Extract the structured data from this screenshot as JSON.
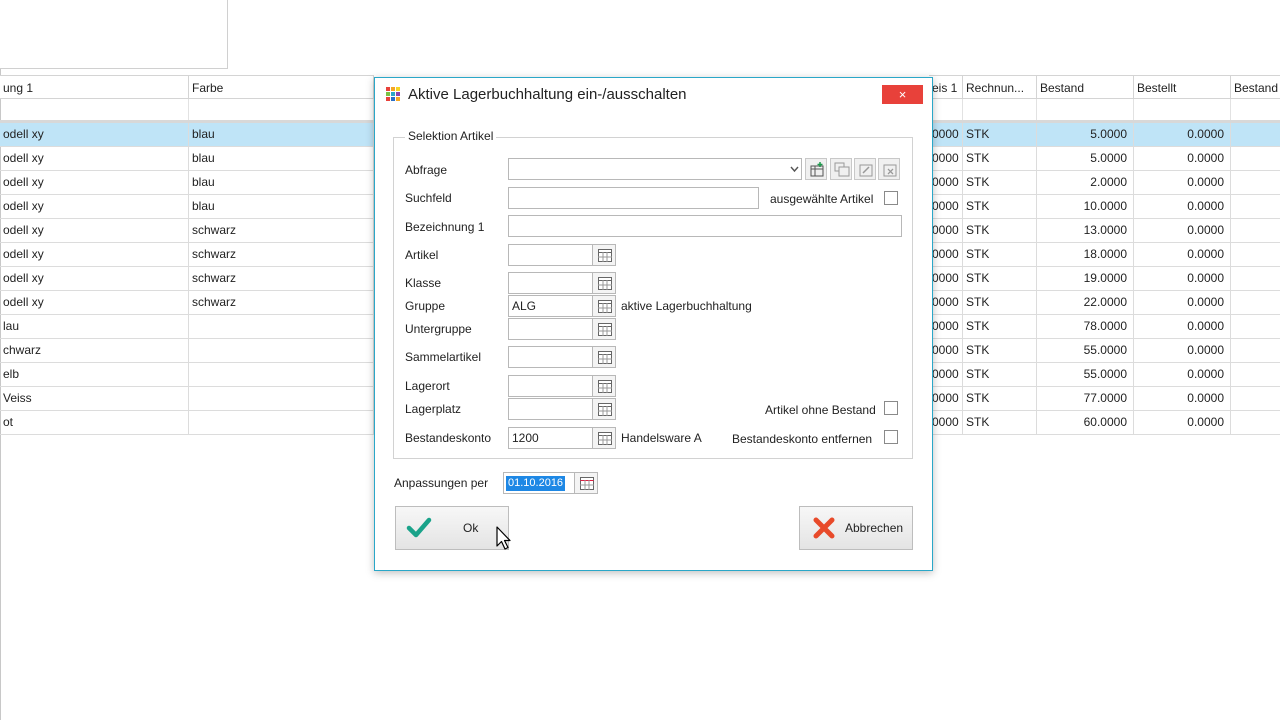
{
  "grid": {
    "columns": [
      {
        "key": "bez1",
        "label": "ung 1"
      },
      {
        "key": "farbe",
        "label": "Farbe"
      },
      {
        "key": "preis",
        "label": "eis 1"
      },
      {
        "key": "einheit",
        "label": "Rechnun..."
      },
      {
        "key": "bestand",
        "label": "Bestand"
      },
      {
        "key": "bestellt",
        "label": "Bestellt"
      },
      {
        "key": "bestand2",
        "label": "Bestand"
      }
    ],
    "rows": [
      {
        "bez1": "odell xy",
        "farbe": "blau",
        "preis": "0000",
        "einheit": "STK",
        "bestand": "5.0000",
        "bestellt": "0.0000",
        "bestand2": ""
      },
      {
        "bez1": "odell xy",
        "farbe": "blau",
        "preis": "0000",
        "einheit": "STK",
        "bestand": "5.0000",
        "bestellt": "0.0000",
        "bestand2": ""
      },
      {
        "bez1": "odell xy",
        "farbe": "blau",
        "preis": "0000",
        "einheit": "STK",
        "bestand": "2.0000",
        "bestellt": "0.0000",
        "bestand2": ""
      },
      {
        "bez1": "odell xy",
        "farbe": "blau",
        "preis": "0000",
        "einheit": "STK",
        "bestand": "10.0000",
        "bestellt": "0.0000",
        "bestand2": ""
      },
      {
        "bez1": "odell xy",
        "farbe": "schwarz",
        "preis": "0000",
        "einheit": "STK",
        "bestand": "13.0000",
        "bestellt": "0.0000",
        "bestand2": ""
      },
      {
        "bez1": "odell xy",
        "farbe": "schwarz",
        "preis": "0000",
        "einheit": "STK",
        "bestand": "18.0000",
        "bestellt": "0.0000",
        "bestand2": ""
      },
      {
        "bez1": "odell xy",
        "farbe": "schwarz",
        "preis": "0000",
        "einheit": "STK",
        "bestand": "19.0000",
        "bestellt": "0.0000",
        "bestand2": ""
      },
      {
        "bez1": "odell xy",
        "farbe": "schwarz",
        "preis": "0000",
        "einheit": "STK",
        "bestand": "22.0000",
        "bestellt": "0.0000",
        "bestand2": ""
      },
      {
        "bez1": "lau",
        "farbe": "",
        "preis": "0000",
        "einheit": "STK",
        "bestand": "78.0000",
        "bestellt": "0.0000",
        "bestand2": ""
      },
      {
        "bez1": "chwarz",
        "farbe": "",
        "preis": "0000",
        "einheit": "STK",
        "bestand": "55.0000",
        "bestellt": "0.0000",
        "bestand2": ""
      },
      {
        "bez1": "elb",
        "farbe": "",
        "preis": "0000",
        "einheit": "STK",
        "bestand": "55.0000",
        "bestellt": "0.0000",
        "bestand2": ""
      },
      {
        "bez1": "Veiss",
        "farbe": "",
        "preis": "0000",
        "einheit": "STK",
        "bestand": "77.0000",
        "bestellt": "0.0000",
        "bestand2": ""
      },
      {
        "bez1": "ot",
        "farbe": "",
        "preis": "0000",
        "einheit": "STK",
        "bestand": "60.0000",
        "bestellt": "0.0000",
        "bestand2": ""
      }
    ],
    "selected_row": 0
  },
  "dialog": {
    "title": "Aktive Lagerbuchhaltung ein-/ausschalten",
    "close_icon": "×",
    "group_title": "Selektion Artikel",
    "abfrage": {
      "label": "Abfrage",
      "value": ""
    },
    "suchfeld": {
      "label": "Suchfeld",
      "value": ""
    },
    "ausgewaehlte": {
      "label": "ausgewählte Artikel",
      "checked": false
    },
    "bezeichnung": {
      "label": "Bezeichnung 1",
      "value": ""
    },
    "artikel": {
      "label": "Artikel",
      "value": ""
    },
    "klasse": {
      "label": "Klasse",
      "value": ""
    },
    "gruppe": {
      "label": "Gruppe",
      "value": "ALG",
      "desc": "aktive Lagerbuchhaltung"
    },
    "untergruppe": {
      "label": "Untergruppe",
      "value": ""
    },
    "sammelartikel": {
      "label": "Sammelartikel",
      "value": ""
    },
    "lagerort": {
      "label": "Lagerort",
      "value": ""
    },
    "lagerplatz": {
      "label": "Lagerplatz",
      "value": ""
    },
    "ohne_bestand": {
      "label": "Artikel ohne Bestand",
      "checked": false
    },
    "bestandeskonto": {
      "label": "Bestandeskonto",
      "value": "1200",
      "desc": "Handelsware A"
    },
    "konto_entfernen": {
      "label": "Bestandeskonto entfernen",
      "checked": false
    },
    "anpassungen": {
      "label": "Anpassungen per",
      "value": "01.10.2016"
    },
    "ok_label": "Ok",
    "cancel_label": "Abbrechen"
  },
  "colors": {
    "accent": "#2aa7c8",
    "selection": "#bfe4f7",
    "close": "#e8413a",
    "ok_check": "#1aa38a",
    "cancel_x": "#e84a2a"
  }
}
